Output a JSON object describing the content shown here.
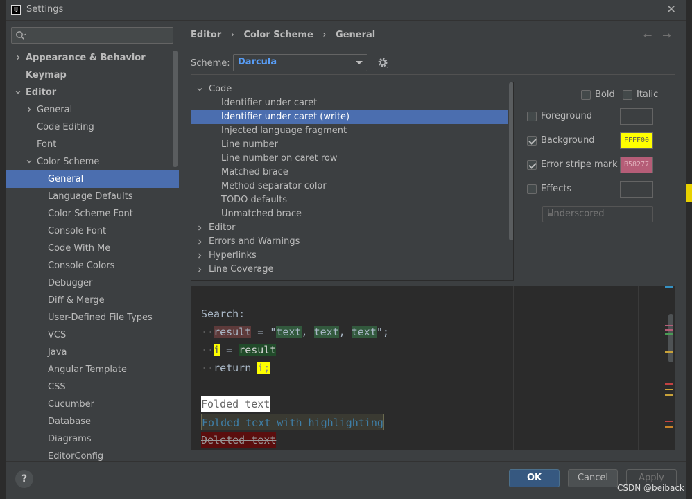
{
  "window": {
    "title": "Settings",
    "app_icon": "IJ",
    "close_glyph": "✕"
  },
  "sidebar": {
    "search_placeholder": "",
    "items": [
      {
        "label": "Appearance & Behavior",
        "level": 0,
        "chevron": "right",
        "bold": true
      },
      {
        "label": "Keymap",
        "level": 0,
        "chevron": "",
        "bold": true
      },
      {
        "label": "Editor",
        "level": 0,
        "chevron": "down",
        "bold": true
      },
      {
        "label": "General",
        "level": 1,
        "chevron": "right"
      },
      {
        "label": "Code Editing",
        "level": 1,
        "chevron": ""
      },
      {
        "label": "Font",
        "level": 1,
        "chevron": ""
      },
      {
        "label": "Color Scheme",
        "level": 1,
        "chevron": "down"
      },
      {
        "label": "General",
        "level": 2,
        "chevron": "",
        "selected": true
      },
      {
        "label": "Language Defaults",
        "level": 2,
        "chevron": ""
      },
      {
        "label": "Color Scheme Font",
        "level": 2,
        "chevron": ""
      },
      {
        "label": "Console Font",
        "level": 2,
        "chevron": ""
      },
      {
        "label": "Code With Me",
        "level": 2,
        "chevron": ""
      },
      {
        "label": "Console Colors",
        "level": 2,
        "chevron": ""
      },
      {
        "label": "Debugger",
        "level": 2,
        "chevron": ""
      },
      {
        "label": "Diff & Merge",
        "level": 2,
        "chevron": ""
      },
      {
        "label": "User-Defined File Types",
        "level": 2,
        "chevron": ""
      },
      {
        "label": "VCS",
        "level": 2,
        "chevron": ""
      },
      {
        "label": "Java",
        "level": 2,
        "chevron": ""
      },
      {
        "label": "Angular Template",
        "level": 2,
        "chevron": ""
      },
      {
        "label": "CSS",
        "level": 2,
        "chevron": ""
      },
      {
        "label": "Cucumber",
        "level": 2,
        "chevron": ""
      },
      {
        "label": "Database",
        "level": 2,
        "chevron": ""
      },
      {
        "label": "Diagrams",
        "level": 2,
        "chevron": ""
      },
      {
        "label": "EditorConfig",
        "level": 2,
        "chevron": ""
      }
    ]
  },
  "breadcrumb": [
    "Editor",
    "Color Scheme",
    "General"
  ],
  "breadcrumb_sep": "›",
  "nav": {
    "back": "←",
    "forward": "→"
  },
  "scheme": {
    "label": "Scheme:",
    "value": "Darcula"
  },
  "options_tree": [
    {
      "label": "Code",
      "level": 0,
      "chevron": "down"
    },
    {
      "label": "Identifier under caret",
      "level": 1,
      "chevron": ""
    },
    {
      "label": "Identifier under caret (write)",
      "level": 1,
      "chevron": "",
      "selected": true
    },
    {
      "label": "Injected language fragment",
      "level": 1,
      "chevron": ""
    },
    {
      "label": "Line number",
      "level": 1,
      "chevron": ""
    },
    {
      "label": "Line number on caret row",
      "level": 1,
      "chevron": ""
    },
    {
      "label": "Matched brace",
      "level": 1,
      "chevron": ""
    },
    {
      "label": "Method separator color",
      "level": 1,
      "chevron": ""
    },
    {
      "label": "TODO defaults",
      "level": 1,
      "chevron": ""
    },
    {
      "label": "Unmatched brace",
      "level": 1,
      "chevron": ""
    },
    {
      "label": "Editor",
      "level": 0,
      "chevron": "right"
    },
    {
      "label": "Errors and Warnings",
      "level": 0,
      "chevron": "right"
    },
    {
      "label": "Hyperlinks",
      "level": 0,
      "chevron": "right"
    },
    {
      "label": "Line Coverage",
      "level": 0,
      "chevron": "right"
    }
  ],
  "font_style": {
    "bold_label": "Bold",
    "bold_checked": false,
    "italic_label": "Italic",
    "italic_checked": false
  },
  "attributes": {
    "foreground": {
      "label": "Foreground",
      "checked": false,
      "value": "",
      "color": ""
    },
    "background": {
      "label": "Background",
      "checked": true,
      "value": "FFFF00",
      "color": "#ffff00"
    },
    "error_stripe": {
      "label": "Error stripe mark",
      "checked": true,
      "value": "B58277",
      "color": "#b55d77"
    },
    "effects": {
      "label": "Effects",
      "checked": false,
      "value": "",
      "color": ""
    },
    "effect_type": "Underscored"
  },
  "preview": {
    "search_label": "Search:",
    "line1": {
      "var": "result",
      "eq": " = \"",
      "t1": "text",
      "sep1": ", ",
      "t2": "text",
      "sep2": ", ",
      "t3": "text",
      "end": "\";"
    },
    "line2": {
      "var": "i",
      "eq": " = ",
      "val": "result"
    },
    "line3": {
      "kw": "return ",
      "var": "i;"
    },
    "folded": "Folded text",
    "folded_hl": "Folded text with highlighting",
    "deleted": "Deleted text"
  },
  "buttons": {
    "help": "?",
    "ok": "OK",
    "cancel": "Cancel",
    "apply": "Apply"
  },
  "watermark": "CSDN @beiback",
  "colors": {
    "selection": "#4b6eaf",
    "link": "#589df6",
    "ok_button": "#365880"
  }
}
